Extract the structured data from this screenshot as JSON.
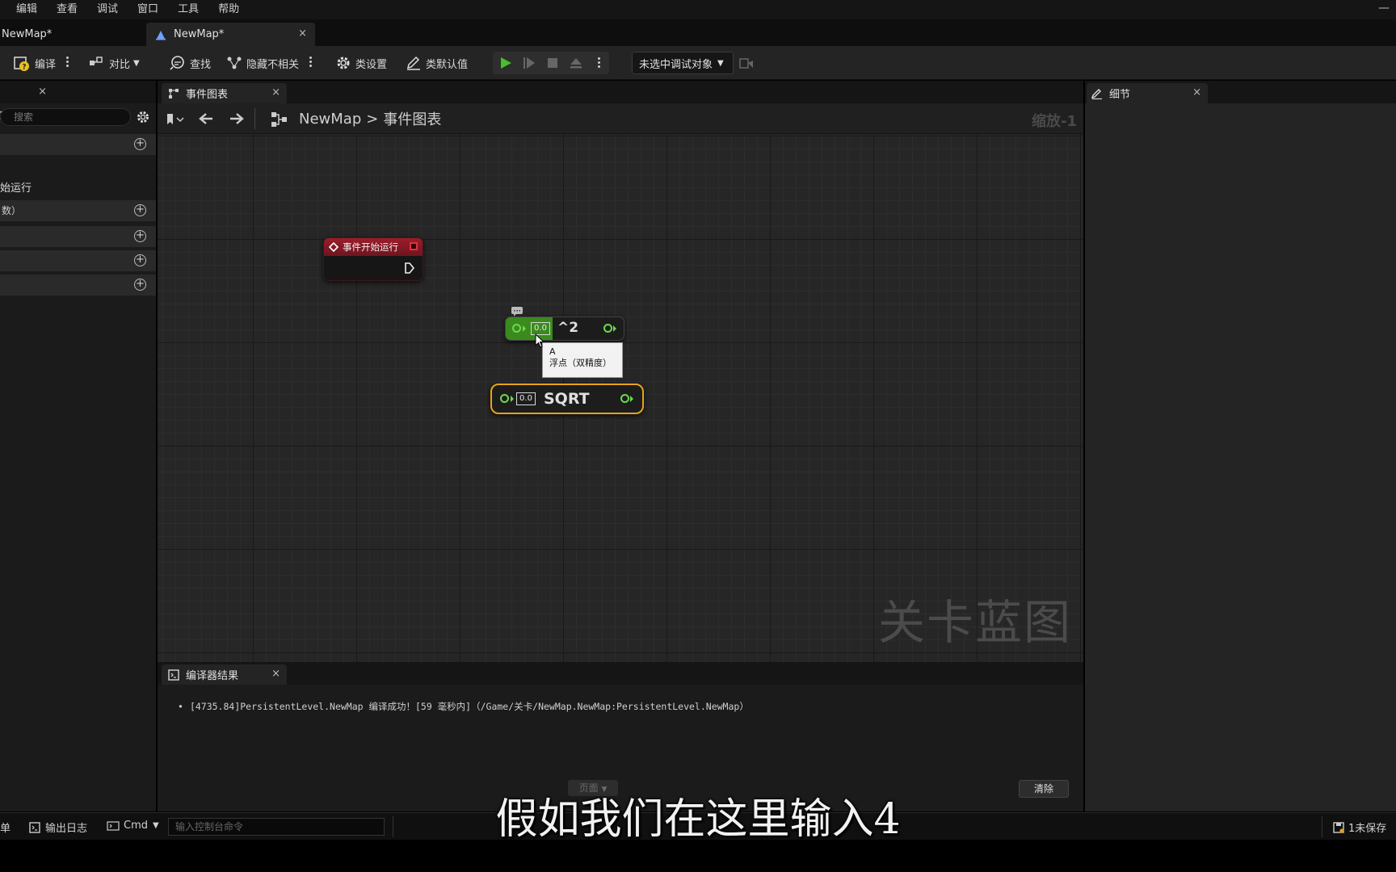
{
  "menu": [
    "编辑",
    "查看",
    "调试",
    "窗口",
    "工具",
    "帮助"
  ],
  "tabs": {
    "left_label": "NewMap*",
    "active_label": "NewMap*",
    "close": "×"
  },
  "toolbar": {
    "compile": "编译",
    "diff": "对比",
    "find": "查找",
    "hide_unrelated": "隐藏不相关",
    "class_settings": "类设置",
    "class_defaults": "类默认值",
    "debug_target": "未选中调试对象"
  },
  "left_panel": {
    "close": "×",
    "search_placeholder": "搜索",
    "section_label": "始运行",
    "row_label": "数）",
    "plus": "+"
  },
  "graph": {
    "tab_label": "事件图表",
    "breadcrumb_root": "NewMap",
    "breadcrumb_sep": ">",
    "breadcrumb_leaf": "事件图表",
    "zoom": "缩放-1",
    "watermark": "关卡蓝图"
  },
  "nodes": {
    "begin_play": {
      "title": "事件开始运行"
    },
    "square": {
      "input_value": "0.0",
      "title": "^2"
    },
    "sqrt": {
      "input_value": "0.0",
      "title": "SQRT"
    },
    "tooltip": {
      "line1": "A",
      "line2": "浮点（双精度）"
    }
  },
  "results": {
    "tab_label": "编译器结果",
    "line": "[4735.84]PersistentLevel.NewMap 编译成功！[59 毫秒内]（/Game/关卡/NewMap.NewMap:PersistentLevel.NewMap）",
    "page_label": "页面",
    "clear_label": "清除"
  },
  "details": {
    "tab_label": "细节"
  },
  "statusbar": {
    "left_fragment": "单",
    "output_log": "输出日志",
    "cmd": "Cmd",
    "console_placeholder": "输入控制台命令",
    "unsaved": "1未保存"
  },
  "subtitle": "假如我们在这里输入4",
  "colors": {
    "event_red": "#9c1d2a",
    "pin_green": "#6ed84e",
    "select_orange": "#e8a21a"
  }
}
